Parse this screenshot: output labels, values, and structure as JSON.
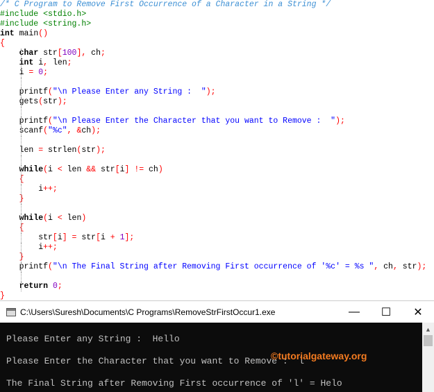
{
  "editor": {
    "lines": [
      {
        "indent": 0,
        "tokens": [
          [
            "c",
            "/* C Program to Remove First Occurrence of a Character in a String */"
          ]
        ]
      },
      {
        "indent": 0,
        "tokens": [
          [
            "p",
            "#include <stdio.h>"
          ]
        ]
      },
      {
        "indent": 0,
        "tokens": [
          [
            "p",
            "#include <string.h>"
          ]
        ]
      },
      {
        "indent": 0,
        "tokens": [
          [
            "k",
            "int"
          ],
          [
            "t",
            " main"
          ],
          [
            "o",
            "()"
          ]
        ]
      },
      {
        "indent": 0,
        "tokens": [
          [
            "o",
            "{"
          ]
        ]
      },
      {
        "indent": 1,
        "tokens": [
          [
            "t",
            "    "
          ],
          [
            "k",
            "char"
          ],
          [
            "t",
            " str"
          ],
          [
            "o",
            "["
          ],
          [
            "n",
            "100"
          ],
          [
            "o",
            "],"
          ],
          [
            "t",
            " ch"
          ],
          [
            "o",
            ";"
          ]
        ]
      },
      {
        "indent": 1,
        "tokens": [
          [
            "t",
            "    "
          ],
          [
            "k",
            "int"
          ],
          [
            "t",
            " i"
          ],
          [
            "o",
            ","
          ],
          [
            "t",
            " len"
          ],
          [
            "o",
            ";"
          ]
        ]
      },
      {
        "indent": 1,
        "tokens": [
          [
            "t",
            "    i "
          ],
          [
            "o",
            "="
          ],
          [
            "t",
            " "
          ],
          [
            "n",
            "0"
          ],
          [
            "o",
            ";"
          ]
        ]
      },
      {
        "indent": 1,
        "tokens": []
      },
      {
        "indent": 1,
        "tokens": [
          [
            "t",
            "    printf"
          ],
          [
            "o",
            "("
          ],
          [
            "s",
            "\"\\n Please Enter any String :  \""
          ],
          [
            "o",
            ");"
          ]
        ]
      },
      {
        "indent": 1,
        "tokens": [
          [
            "t",
            "    gets"
          ],
          [
            "o",
            "("
          ],
          [
            "t",
            "str"
          ],
          [
            "o",
            ");"
          ]
        ]
      },
      {
        "indent": 1,
        "tokens": []
      },
      {
        "indent": 1,
        "tokens": [
          [
            "t",
            "    printf"
          ],
          [
            "o",
            "("
          ],
          [
            "s",
            "\"\\n Please Enter the Character that you want to Remove :  \""
          ],
          [
            "o",
            ");"
          ]
        ]
      },
      {
        "indent": 1,
        "tokens": [
          [
            "t",
            "    scanf"
          ],
          [
            "o",
            "("
          ],
          [
            "s",
            "\"%c\""
          ],
          [
            "o",
            ", &"
          ],
          [
            "t",
            "ch"
          ],
          [
            "o",
            ");"
          ]
        ]
      },
      {
        "indent": 1,
        "tokens": []
      },
      {
        "indent": 1,
        "tokens": [
          [
            "t",
            "    len "
          ],
          [
            "o",
            "="
          ],
          [
            "t",
            " strlen"
          ],
          [
            "o",
            "("
          ],
          [
            "t",
            "str"
          ],
          [
            "o",
            ");"
          ]
        ]
      },
      {
        "indent": 1,
        "tokens": []
      },
      {
        "indent": 1,
        "tokens": [
          [
            "t",
            "    "
          ],
          [
            "k",
            "while"
          ],
          [
            "o",
            "("
          ],
          [
            "t",
            "i "
          ],
          [
            "o",
            "<"
          ],
          [
            "t",
            " len "
          ],
          [
            "o",
            "&&"
          ],
          [
            "t",
            " str"
          ],
          [
            "o",
            "["
          ],
          [
            "t",
            "i"
          ],
          [
            "o",
            "]"
          ],
          [
            "t",
            " "
          ],
          [
            "o",
            "!="
          ],
          [
            "t",
            " ch"
          ],
          [
            "o",
            ")"
          ]
        ]
      },
      {
        "indent": 1,
        "tokens": [
          [
            "t",
            "    "
          ],
          [
            "o",
            "{"
          ]
        ]
      },
      {
        "indent": 1,
        "tokens": [
          [
            "t",
            "        i"
          ],
          [
            "o",
            "++;"
          ]
        ]
      },
      {
        "indent": 1,
        "tokens": [
          [
            "t",
            "    "
          ],
          [
            "o",
            "}"
          ]
        ]
      },
      {
        "indent": 1,
        "tokens": []
      },
      {
        "indent": 1,
        "tokens": [
          [
            "t",
            "    "
          ],
          [
            "k",
            "while"
          ],
          [
            "o",
            "("
          ],
          [
            "t",
            "i "
          ],
          [
            "o",
            "<"
          ],
          [
            "t",
            " len"
          ],
          [
            "o",
            ")"
          ]
        ]
      },
      {
        "indent": 1,
        "tokens": [
          [
            "t",
            "    "
          ],
          [
            "o",
            "{"
          ]
        ]
      },
      {
        "indent": 1,
        "tokens": [
          [
            "t",
            "        str"
          ],
          [
            "o",
            "["
          ],
          [
            "t",
            "i"
          ],
          [
            "o",
            "]"
          ],
          [
            "t",
            " "
          ],
          [
            "o",
            "="
          ],
          [
            "t",
            " str"
          ],
          [
            "o",
            "["
          ],
          [
            "t",
            "i "
          ],
          [
            "o",
            "+"
          ],
          [
            "t",
            " "
          ],
          [
            "n",
            "1"
          ],
          [
            "o",
            "];"
          ]
        ]
      },
      {
        "indent": 1,
        "tokens": [
          [
            "t",
            "        i"
          ],
          [
            "o",
            "++;"
          ]
        ]
      },
      {
        "indent": 1,
        "tokens": [
          [
            "t",
            "    "
          ],
          [
            "o",
            "}"
          ]
        ]
      },
      {
        "indent": 1,
        "tokens": [
          [
            "t",
            "    printf"
          ],
          [
            "o",
            "("
          ],
          [
            "s",
            "\"\\n The Final String after Removing First occurrence of '%c' = %s \""
          ],
          [
            "o",
            ","
          ],
          [
            "t",
            " ch"
          ],
          [
            "o",
            ","
          ],
          [
            "t",
            " str"
          ],
          [
            "o",
            ");"
          ]
        ]
      },
      {
        "indent": 1,
        "tokens": []
      },
      {
        "indent": 1,
        "tokens": [
          [
            "t",
            "    "
          ],
          [
            "k",
            "return"
          ],
          [
            "t",
            " "
          ],
          [
            "n",
            "0"
          ],
          [
            "o",
            ";"
          ]
        ]
      },
      {
        "indent": 0,
        "tokens": [
          [
            "o",
            "}"
          ]
        ]
      }
    ]
  },
  "console": {
    "title": "C:\\Users\\Suresh\\Documents\\C Programs\\RemoveStrFirstOccur1.exe",
    "minimize": "—",
    "maximize": "☐",
    "close": "✕",
    "output": [
      "Please Enter any String :  Hello",
      "Please Enter the Character that you want to Remove :  l",
      "The Final String after Removing First occurrence of 'l' = Helo"
    ],
    "watermark": "©tutorialgateway.org",
    "scroll_up": "▲"
  }
}
